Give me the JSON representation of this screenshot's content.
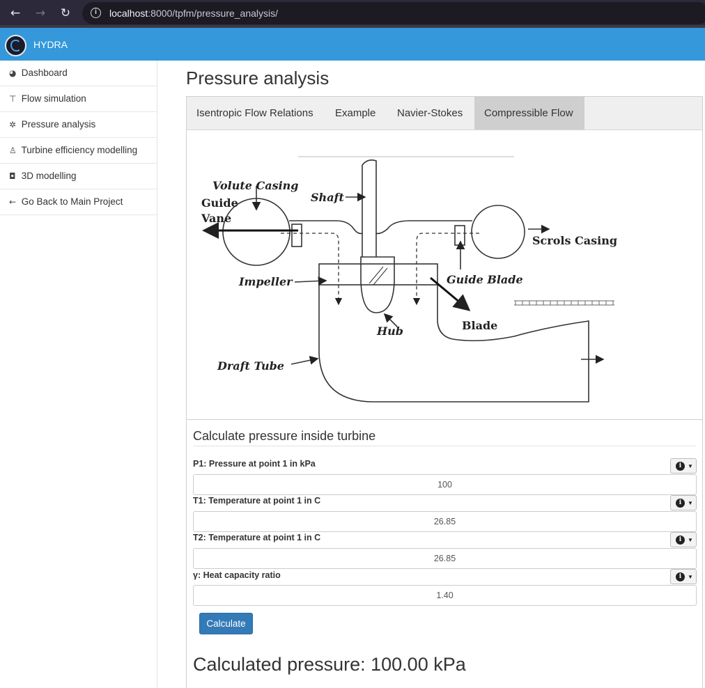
{
  "browser": {
    "url_host": "localhost",
    "url_rest": ":8000/tpfm/pressure_analysis/"
  },
  "app": {
    "brand": "HYDRA"
  },
  "sidebar": {
    "items": [
      {
        "icon": "dashboard-icon",
        "label": "Dashboard"
      },
      {
        "icon": "pin-icon",
        "label": "Flow simulation"
      },
      {
        "icon": "gear-icon",
        "label": "Pressure analysis"
      },
      {
        "icon": "user-icon",
        "label": "Turbine efficiency modelling"
      },
      {
        "icon": "cube-icon",
        "label": "3D modelling"
      },
      {
        "icon": "arrow-left-icon",
        "label": "Go Back to Main Project"
      }
    ]
  },
  "main": {
    "title": "Pressure analysis",
    "tabs": [
      {
        "label": "Isentropic Flow Relations",
        "active": false
      },
      {
        "label": "Example",
        "active": false
      },
      {
        "label": "Navier-Stokes",
        "active": false
      },
      {
        "label": "Compressible Flow",
        "active": true
      }
    ],
    "diagram": {
      "labels": {
        "volute_casing": "Volute Casing",
        "guide": "Guide",
        "vane": "Vane",
        "shaft": "Shaft",
        "scrols_casing": "Scrols Casing",
        "impeller": "Impeller",
        "guide_blade": "Guide Blade",
        "hub": "Hub",
        "blade": "Blade",
        "draft_tube": "Draft Tube"
      }
    },
    "form": {
      "title": "Calculate pressure inside turbine",
      "fields": [
        {
          "label": "P1: Pressure at point 1 in kPa",
          "value": "100"
        },
        {
          "label": "T1: Temperature at point 1 in C",
          "value": "26.85"
        },
        {
          "label": "T2: Temperature at point 1 in C",
          "value": "26.85"
        },
        {
          "label": "γ: Heat capacity ratio",
          "value": "1.40"
        }
      ],
      "submit_label": "Calculate"
    },
    "result": "Calculated pressure: 100.00 kPa"
  },
  "colors": {
    "header": "#3498db",
    "primary_button": "#337ab7",
    "active_tab": "#cfcfcf"
  }
}
